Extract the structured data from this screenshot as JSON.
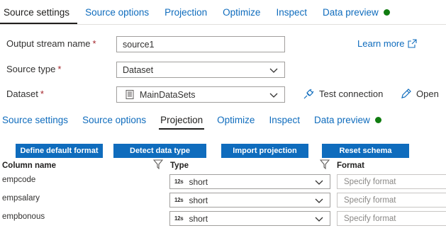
{
  "top_tabs": [
    {
      "label": "Source settings",
      "active": true
    },
    {
      "label": "Source options",
      "active": false
    },
    {
      "label": "Projection",
      "active": false
    },
    {
      "label": "Optimize",
      "active": false
    },
    {
      "label": "Inspect",
      "active": false
    },
    {
      "label": "Data preview",
      "active": false,
      "status_dot": "#107c10"
    }
  ],
  "form": {
    "output_stream": {
      "label": "Output stream name",
      "required": "*",
      "value": "source1"
    },
    "source_type": {
      "label": "Source type",
      "required": "*",
      "value": "Dataset"
    },
    "dataset": {
      "label": "Dataset",
      "required": "*",
      "value": "MainDataSets"
    },
    "learn_more": "Learn more",
    "test_connection": "Test connection",
    "open": "Open"
  },
  "inner_tabs": [
    {
      "label": "Source settings",
      "active": false
    },
    {
      "label": "Source options",
      "active": false
    },
    {
      "label": "Projection",
      "active": true
    },
    {
      "label": "Optimize",
      "active": false
    },
    {
      "label": "Inspect",
      "active": false
    },
    {
      "label": "Data preview",
      "active": false,
      "status_dot": "#107c10"
    }
  ],
  "buttons": {
    "define_default_format": "Define default format",
    "detect_data_type": "Detect data type",
    "import_projection": "Import projection",
    "reset_schema": "Reset schema"
  },
  "columns": {
    "name": "Column name",
    "type": "Type",
    "format": "Format"
  },
  "rows": [
    {
      "name": "empcode",
      "type_badge": "12s",
      "type": "short",
      "format_placeholder": "Specify format"
    },
    {
      "name": "empsalary",
      "type_badge": "12s",
      "type": "short",
      "format_placeholder": "Specify format"
    },
    {
      "name": "empbonous",
      "type_badge": "12s",
      "type": "short",
      "format_placeholder": "Specify format"
    }
  ],
  "colors": {
    "accent": "#0f6cbd",
    "status_green": "#107c10",
    "required": "#a4262c"
  }
}
